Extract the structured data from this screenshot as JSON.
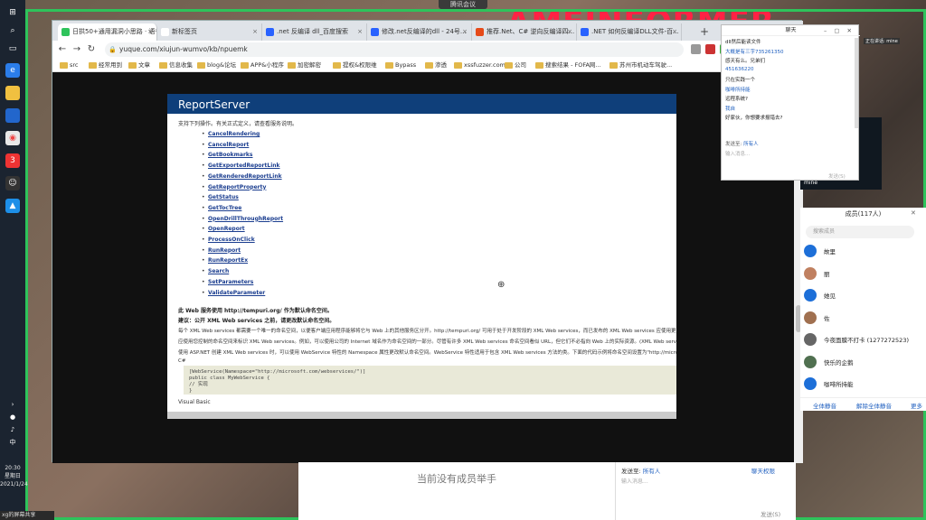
{
  "meeting": {
    "indicator": "腾讯会议",
    "host_label": "正在讲话: mine"
  },
  "taskbar": {
    "time": "20:30",
    "weekday": "星期日",
    "date": "2021/1/24",
    "bottom_label": "xg的屏幕共享"
  },
  "browser": {
    "tabs": [
      {
        "label": "日拱50+通用漏洞小思路 · 语雀",
        "active": true,
        "color": "#2ec35b"
      },
      {
        "label": "新标签页",
        "active": false,
        "color": "#ffffff"
      },
      {
        "label": ".net 反编译 dll_百度搜索",
        "active": false,
        "color": "#2962ff"
      },
      {
        "label": "修改.net反编译的dll - 24号...",
        "active": false,
        "color": "#2962ff"
      },
      {
        "label": "推荐.Net、C# 逆向反编译四...",
        "active": false,
        "color": "#e64a19"
      },
      {
        "label": ".NET 如何反编译DLL文件-百...",
        "active": false,
        "color": "#2962ff"
      }
    ],
    "url": "yuque.com/xiujun-wumvo/kb/npuemk",
    "bookmarks": [
      "src",
      "经常用到",
      "文章",
      "信息收集",
      "blog&论坛",
      "APP&小程序",
      "加密解密",
      "提权&权限维",
      "Bypass",
      "渗透",
      "xssfuzzer.com",
      "公司",
      "搜索结果 - FOFA网...",
      "苏州市机动车驾驶..."
    ]
  },
  "doc": {
    "title": "ReportServer",
    "intro": "支持下列操作。有关正式定义，请查看服务说明。",
    "operations": [
      "CancelRendering",
      "CancelReport",
      "GetBookmarks",
      "GetExportedReportLink",
      "GetRenderedReportLink",
      "GetReportProperty",
      "GetStatus",
      "GetTocTree",
      "OpenDrillThroughReport",
      "OpenReport",
      "ProcessOnClick",
      "RunReport",
      "RunReportEx",
      "Search",
      "SetParameters",
      "ValidateParameter"
    ],
    "para1": "此 Web 服务使用 http://tempuri.org/ 作为默认命名空间。",
    "para2": "建议：公开 XML Web services 之前，请更改默认命名空间。",
    "para3": "每个 XML Web services 都需要一个唯一的命名空间，以便客户端应用程序能够将它与 Web 上的其他服务区分开。http://tempuri.org/ 可用于处于开发阶段的 XML Web services，而已发布的 XML Web services 应使用更为永久的命名空间。",
    "para4": "应使用您控制的命名空间来标识 XML Web services。例如，可以使用公司的 Internet 域名作为命名空间的一部分。尽管有许多 XML Web services 命名空间看似 URL，但它们不必指向 Web 上的实际资源。(XML Web services 命名空间为 URI。)",
    "para5": "使用 ASP.NET 创建 XML Web services 时，可以使用 WebService 特性的 Namespace 属性更改默认命名空间。WebService 特性适用于包含 XML Web services 方法的类。下面的代码示例将命名空间设置为\"http://microsoft.com/webservices/\"：",
    "lang1": "C#",
    "code": [
      "[WebService(Namespace=\"http://microsoft.com/webservices/\")]",
      "public class MyWebService {",
      "    // 实现",
      "}"
    ],
    "lang2": "Visual Basic"
  },
  "chat": {
    "title": "聊天",
    "messages": [
      {
        "type": "body",
        "text": "dll然后能读文件"
      },
      {
        "type": "name",
        "text": "大概是有三字735261350"
      },
      {
        "type": "body",
        "text": "感天有么。兄弟们"
      },
      {
        "type": "name",
        "text": "451636220"
      },
      {
        "type": "body",
        "text": "只在实践一个"
      },
      {
        "type": "name",
        "text": "咖啡所持能"
      },
      {
        "type": "body",
        "text": "远程系统?"
      },
      {
        "type": "name",
        "text": "我自"
      },
      {
        "type": "body",
        "text": "好家伙，你想要求报错去?"
      }
    ],
    "send_to_label": "发送至:",
    "send_to_value": "所有人",
    "input_placeholder": "输入消息...",
    "send_button": "发送(S)"
  },
  "video": {
    "name": "mine"
  },
  "members": {
    "title": "成员(117人)",
    "search_placeholder": "搜索成员",
    "list": [
      {
        "name": "故里",
        "color": "#1d6fd8"
      },
      {
        "name": "丽",
        "color": "#c08060"
      },
      {
        "name": "她见",
        "color": "#1d6fd8"
      },
      {
        "name": "佐",
        "color": "#a07050"
      },
      {
        "name": "今夜面膜不打卡 (1277272523)",
        "color": "#666"
      },
      {
        "name": "快乐的企鹅",
        "color": "#507050"
      },
      {
        "name": "咖啡所持能",
        "color": "#1d6fd8"
      }
    ],
    "actions": [
      "全体静音",
      "解除全体静音",
      "更多"
    ]
  },
  "handraise": {
    "text": "当前没有成员举手"
  },
  "meeting_chat": {
    "send_to_label": "发送至:",
    "send_to_value": "所有人",
    "permission": "聊天权限",
    "input_placeholder": "输入消息...",
    "send_button": "发送(S)"
  }
}
